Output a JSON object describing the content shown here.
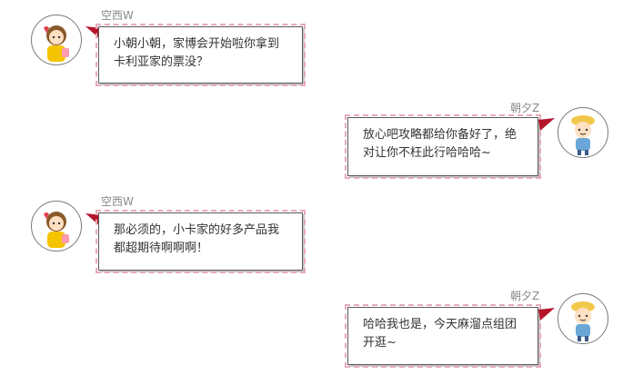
{
  "messages": [
    {
      "sender": "空西W",
      "side": "left",
      "lines": [
        "小朝小朝，家博会开始啦你拿到",
        "卡利亚家的票没？"
      ]
    },
    {
      "sender": "朝夕Z",
      "side": "right",
      "lines": [
        "放心吧攻略都给你备好了，绝",
        "对让你不枉此行哈哈哈~"
      ]
    },
    {
      "sender": "空西W",
      "side": "left",
      "lines": [
        "那必须的，小卡家的好多产品我",
        "都超期待啊啊啊！"
      ]
    },
    {
      "sender": "朝夕Z",
      "side": "right",
      "lines": [
        "哈哈我也是，今天麻溜点组团",
        "开逛~"
      ]
    }
  ],
  "colors": {
    "tail": "#b3142b",
    "border_dash": "#e7aab8",
    "left_avatar_hair": "#8a5a2a",
    "left_avatar_shirt": "#f5c400",
    "right_avatar_hat": "#f2c84b",
    "right_avatar_shirt": "#6aa7d8"
  },
  "icons": {
    "left_avatar": "girl-with-heart-avatar-icon",
    "right_avatar": "boy-with-yellow-hat-avatar-icon"
  }
}
